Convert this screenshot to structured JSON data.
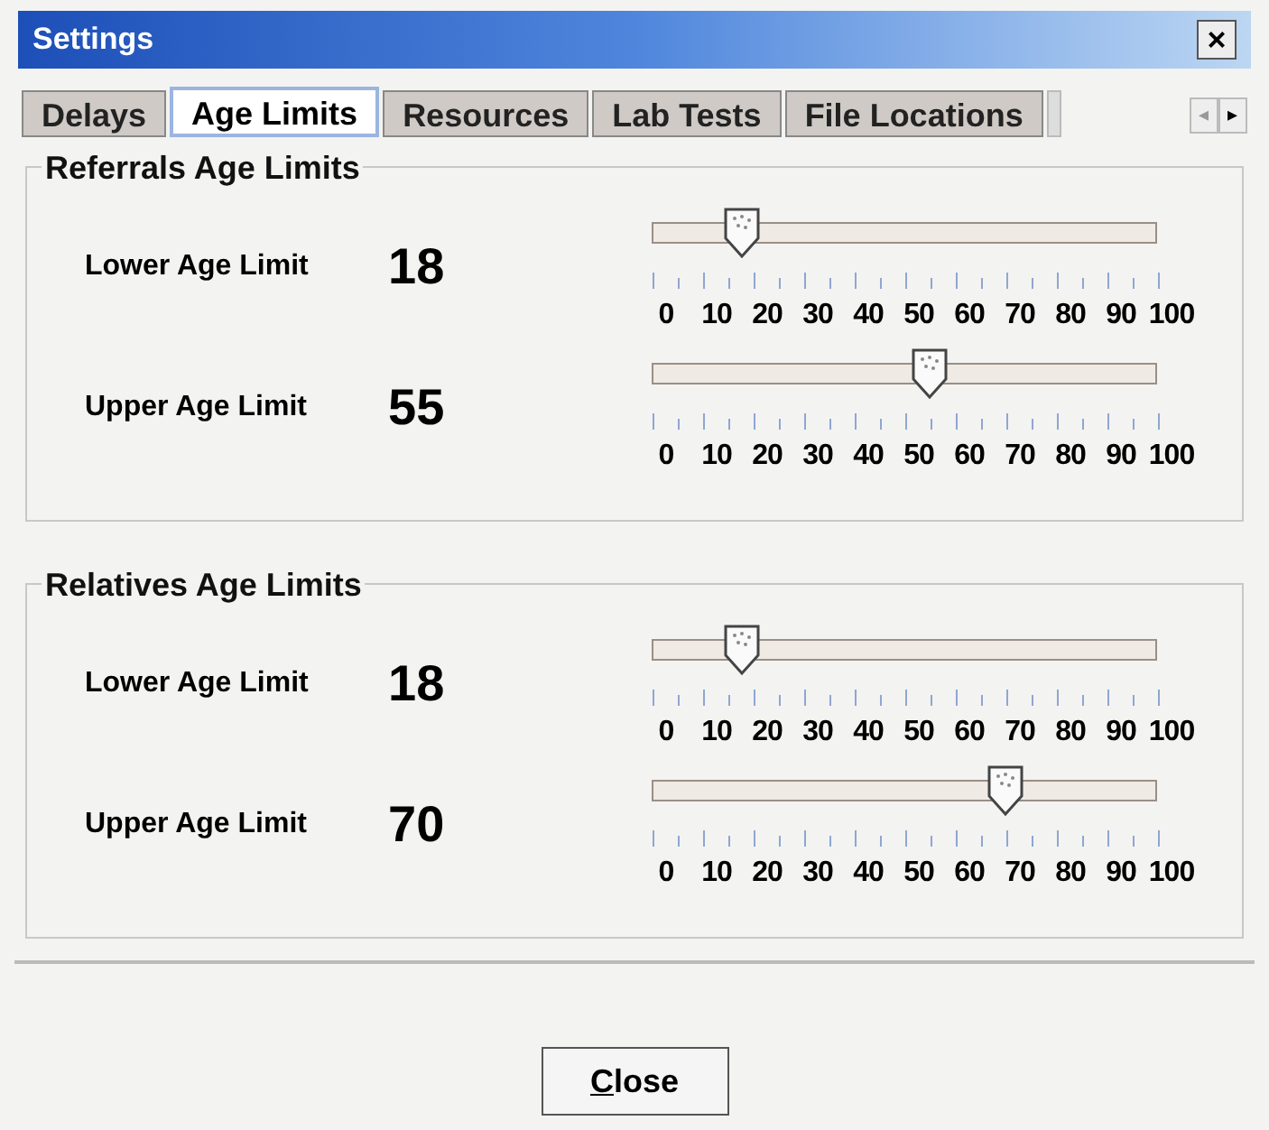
{
  "window": {
    "title": "Settings",
    "close": "×"
  },
  "tabs": [
    {
      "label": "Delays",
      "selected": false
    },
    {
      "label": "Age Limits",
      "selected": true
    },
    {
      "label": "Resources",
      "selected": false
    },
    {
      "label": "Lab Tests",
      "selected": false
    },
    {
      "label": "File Locations",
      "selected": false
    }
  ],
  "tab_scroll": {
    "left": "◂",
    "right": "▸"
  },
  "groups": [
    {
      "title": "Referrals Age Limits",
      "rows": [
        {
          "label": "Lower Age Limit",
          "value": "18",
          "level": 0.18,
          "tick_labels": [
            "0",
            "10",
            "20",
            "30",
            "40",
            "50",
            "60",
            "70",
            "80",
            "90",
            "100"
          ]
        },
        {
          "label": "Upper Age Limit",
          "value": "55",
          "level": 0.55,
          "tick_labels": [
            "0",
            "10",
            "20",
            "30",
            "40",
            "50",
            "60",
            "70",
            "80",
            "90",
            "100"
          ]
        }
      ]
    },
    {
      "title": "Relatives Age Limits",
      "rows": [
        {
          "label": "Lower Age Limit",
          "value": "18",
          "level": 0.18,
          "tick_labels": [
            "0",
            "10",
            "20",
            "30",
            "40",
            "50",
            "60",
            "70",
            "80",
            "90",
            "100"
          ]
        },
        {
          "label": "Upper Age Limit",
          "value": "70",
          "level": 0.7,
          "tick_labels": [
            "0",
            "10",
            "20",
            "30",
            "40",
            "50",
            "60",
            "70",
            "80",
            "90",
            "100"
          ]
        }
      ]
    }
  ],
  "buttons": [
    {
      "label": "Close",
      "mnemonic_underline": true
    }
  ]
}
